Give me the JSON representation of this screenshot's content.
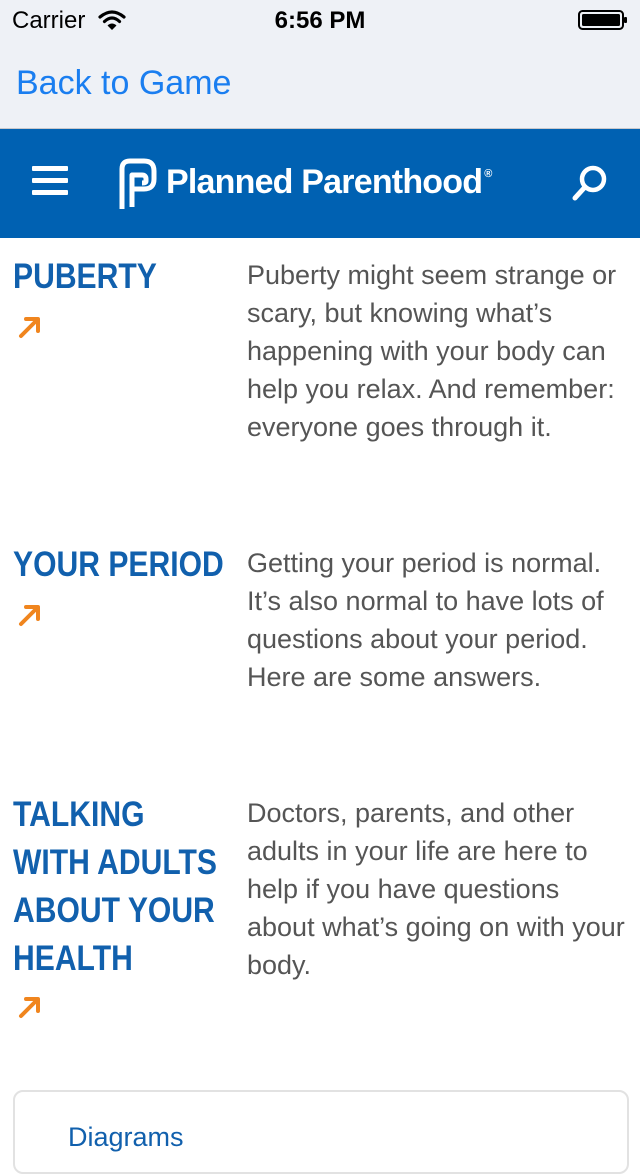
{
  "status_bar": {
    "carrier": "Carrier",
    "time": "6:56 PM"
  },
  "nav": {
    "back_label": "Back to Game"
  },
  "header": {
    "brand": "Planned Parenthood",
    "brand_mark": "®",
    "menu_icon": "hamburger-menu-icon",
    "search_icon": "search-icon",
    "background_color": "#0061b2"
  },
  "topics": [
    {
      "title_lines": [
        "PUBERTY"
      ],
      "description": "Puberty might seem strange or scary, but knowing what’s happening with your body can help you relax. And remember: everyone goes through it.",
      "icon": "arrow-up-right-icon"
    },
    {
      "title_lines": [
        "YOUR PERIOD"
      ],
      "description": "Getting your period is normal. It’s also normal to have lots of questions about your period. Here are some answers.",
      "icon": "arrow-up-right-icon"
    },
    {
      "title_lines": [
        "TALKING",
        "WITH ADULTS",
        "ABOUT YOUR",
        "HEALTH"
      ],
      "description": "Doctors, parents, and other adults in your life are here to help if you have questions about what’s going on with your body.",
      "icon": "arrow-up-right-icon"
    }
  ],
  "card": {
    "link_label": "Diagrams"
  },
  "colors": {
    "link_blue": "#1a7ef0",
    "title_blue": "#1160ad",
    "arrow_orange": "#f0851e",
    "body_text": "#555555"
  }
}
